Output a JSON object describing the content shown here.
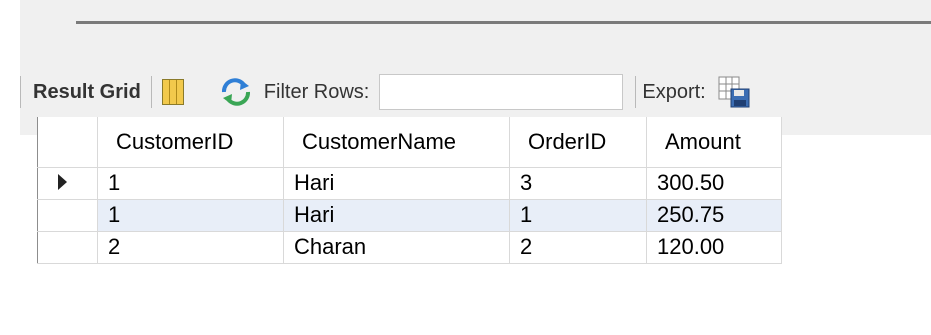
{
  "toolbar": {
    "result_grid_label": "Result Grid",
    "filter_label": "Filter Rows:",
    "filter_value": "",
    "export_label": "Export:"
  },
  "grid": {
    "columns": [
      "CustomerID",
      "CustomerName",
      "OrderID",
      "Amount"
    ],
    "rows": [
      [
        "1",
        "Hari",
        "3",
        "300.50"
      ],
      [
        "1",
        "Hari",
        "1",
        "250.75"
      ],
      [
        "2",
        "Charan",
        "2",
        "120.00"
      ]
    ],
    "current_row_index": 0,
    "highlighted_row_index": 1
  },
  "colors": {
    "toolbar_bg": "#f0f0f0",
    "highlight_row": "#e8eef8",
    "grid_icon": "#f2c94c",
    "refresh_blue": "#2f7fd6",
    "refresh_green": "#3aa655"
  },
  "icons": [
    "grid-toggle-icon",
    "refresh-icon",
    "export-icon",
    "current-row-arrow-icon"
  ]
}
